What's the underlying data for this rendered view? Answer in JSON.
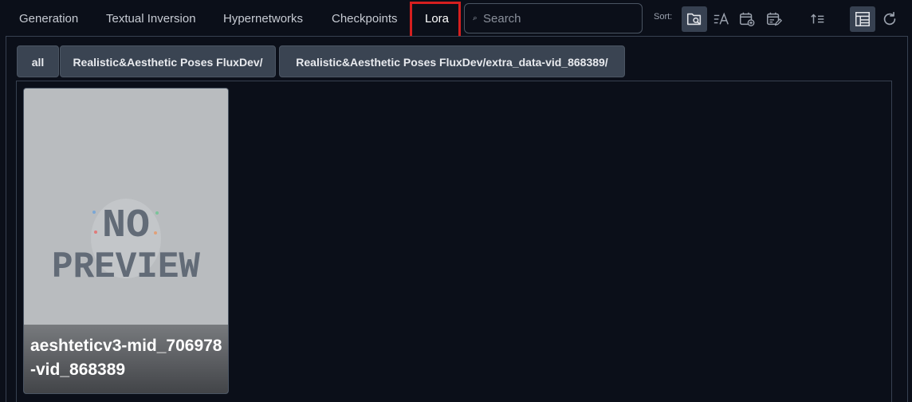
{
  "tabs": [
    {
      "label": "Generation"
    },
    {
      "label": "Textual Inversion"
    },
    {
      "label": "Hypernetworks"
    },
    {
      "label": "Checkpoints"
    },
    {
      "label": "Lora"
    }
  ],
  "selected_tab": "Lora",
  "search": {
    "placeholder": "Search",
    "value": ""
  },
  "sort": {
    "label": "Sort:",
    "buttons": [
      {
        "icon": "sort-search-icon",
        "active": true
      },
      {
        "icon": "sort-name-icon",
        "active": false
      },
      {
        "icon": "sort-date-created-icon",
        "active": false
      },
      {
        "icon": "sort-date-modified-icon",
        "active": false
      },
      {
        "icon": "sort-direction-icon",
        "active": false
      }
    ]
  },
  "view": {
    "tree_view_icon": "tree-view-icon",
    "refresh_icon": "refresh-icon"
  },
  "breadcrumbs": [
    {
      "label": "all"
    },
    {
      "label": "Realistic&Aesthetic Poses FluxDev/"
    },
    {
      "label": "Realistic&Aesthetic Poses FluxDev/extra_data-vid_868389/"
    }
  ],
  "cards": [
    {
      "name": "aeshteticv3-mid_706978-vid_868389",
      "preview_text_line1": "NO",
      "preview_text_line2": "PREVIEW"
    }
  ],
  "colors": {
    "background": "#0b0f19",
    "highlight": "#d61f1f",
    "crumb_bg": "#3a4452",
    "card_bg": "#b9bcbf"
  }
}
